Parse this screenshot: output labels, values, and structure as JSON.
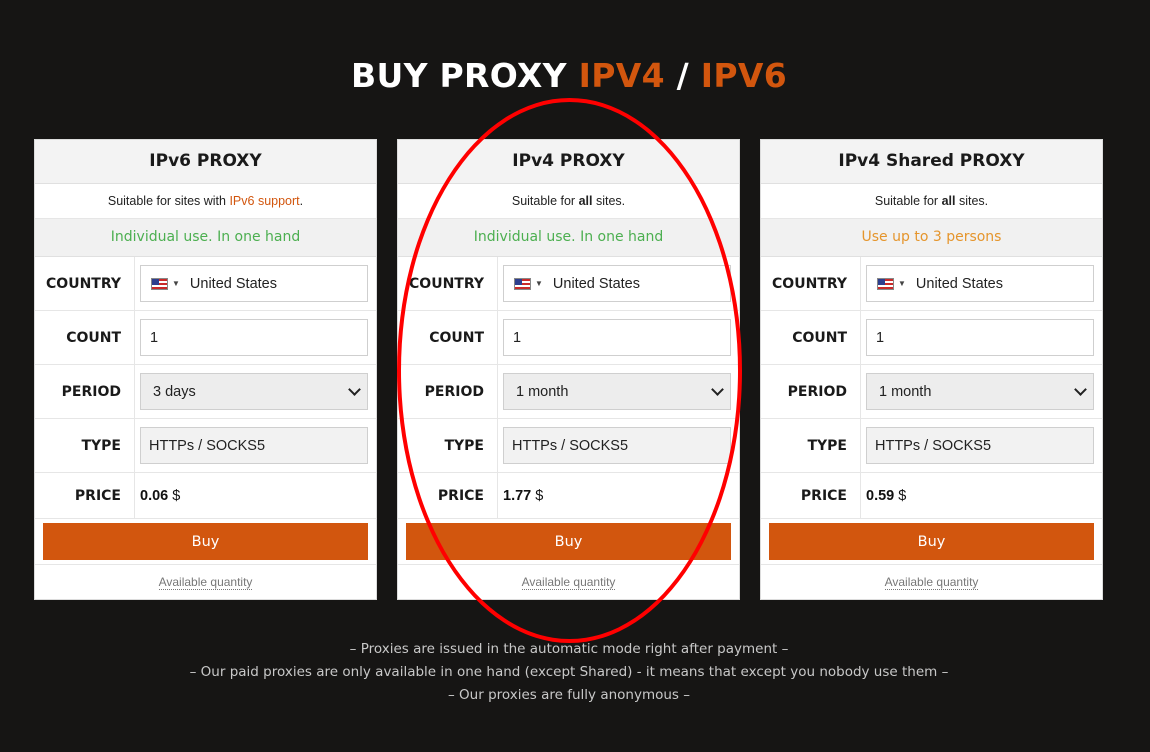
{
  "title": {
    "prefix": "BUY PROXY",
    "ipv4": "IPV4",
    "sep": "/",
    "ipv6": "IPV6"
  },
  "labels": {
    "country": "COUNTRY",
    "count": "COUNT",
    "period": "PERIOD",
    "type": "TYPE",
    "price": "PRICE"
  },
  "cards": [
    {
      "title": "IPv6 PROXY",
      "suit_pre": "Suitable for sites with ",
      "suit_highlight": "IPv6 support",
      "suit_post": ".",
      "use": "Individual use. In one hand",
      "use_color": "#4caf50",
      "country": "United States",
      "count": "1",
      "period": "3 days",
      "type": "HTTPs / SOCKS5",
      "price": "0.06",
      "currency": "$",
      "buy": "Buy",
      "available": "Available quantity"
    },
    {
      "title": "IPv4 PROXY",
      "suit_pre": "Suitable for ",
      "suit_highlight": "all",
      "suit_post": " sites.",
      "use": "Individual use. In one hand",
      "use_color": "#4caf50",
      "country": "United States",
      "count": "1",
      "period": "1 month",
      "type": "HTTPs / SOCKS5",
      "price": "1.77",
      "currency": "$",
      "buy": "Buy",
      "available": "Available quantity"
    },
    {
      "title": "IPv4 Shared PROXY",
      "suit_pre": "Suitable for ",
      "suit_highlight": "all",
      "suit_post": " sites.",
      "use": "Use up to 3 persons",
      "use_color": "#e5952c",
      "country": "United States",
      "count": "1",
      "period": "1 month",
      "type": "HTTPs / SOCKS5",
      "price": "0.59",
      "currency": "$",
      "buy": "Buy",
      "available": "Available quantity"
    }
  ],
  "notes": [
    "– Proxies are issued in the automatic mode right after payment –",
    "– Our paid proxies are only available in one hand (except Shared) - it means that except you nobody use them –",
    "– Our proxies are fully anonymous –"
  ],
  "colors": {
    "accent": "#d2560e",
    "background": "#161514",
    "annotation": "#ff0000"
  }
}
